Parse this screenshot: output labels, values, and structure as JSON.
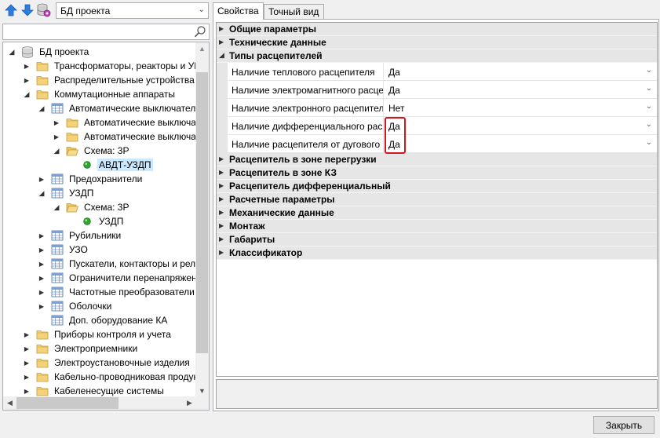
{
  "toolbar": {
    "up_icon": "arrow-up-icon",
    "down_icon": "arrow-down-icon",
    "db_icon": "database-settings-icon",
    "db_select_value": "БД проекта"
  },
  "search": {
    "value": "",
    "icon": "search-icon"
  },
  "tree": {
    "items": [
      {
        "label": "БД проекта",
        "icon": "database",
        "expander": "open",
        "depth": 0
      },
      {
        "label": "Трансформаторы, реакторы и УК",
        "icon": "folder",
        "expander": "closed",
        "depth": 1
      },
      {
        "label": "Распределительные устройства",
        "icon": "folder",
        "expander": "closed",
        "depth": 1
      },
      {
        "label": "Коммутационные аппараты",
        "icon": "folder",
        "expander": "open",
        "depth": 1
      },
      {
        "label": "Автоматические выключатели",
        "icon": "table",
        "expander": "open",
        "depth": 2
      },
      {
        "label": "Автоматические выключатели",
        "icon": "folder",
        "expander": "closed",
        "depth": 3
      },
      {
        "label": "Автоматические выключатели",
        "icon": "folder",
        "expander": "closed",
        "depth": 3
      },
      {
        "label": "Схема: 3P",
        "icon": "folder-open",
        "expander": "open",
        "depth": 3
      },
      {
        "label": "АВДТ-УЗДП",
        "icon": "green-dot",
        "expander": "none",
        "depth": 4,
        "selected": true
      },
      {
        "label": "Предохранители",
        "icon": "table",
        "expander": "closed",
        "depth": 2
      },
      {
        "label": "УЗДП",
        "icon": "table",
        "expander": "open",
        "depth": 2
      },
      {
        "label": "Схема: 3P",
        "icon": "folder-open",
        "expander": "open",
        "depth": 3
      },
      {
        "label": "УЗДП",
        "icon": "green-dot",
        "expander": "none",
        "depth": 4
      },
      {
        "label": "Рубильники",
        "icon": "table",
        "expander": "closed",
        "depth": 2
      },
      {
        "label": "УЗО",
        "icon": "table",
        "expander": "closed",
        "depth": 2
      },
      {
        "label": "Пускатели, контакторы и реле",
        "icon": "table",
        "expander": "closed",
        "depth": 2
      },
      {
        "label": "Ограничители перенапряжения",
        "icon": "table",
        "expander": "closed",
        "depth": 2
      },
      {
        "label": "Частотные преобразователи",
        "icon": "table",
        "expander": "closed",
        "depth": 2
      },
      {
        "label": "Оболочки",
        "icon": "table",
        "expander": "closed",
        "depth": 2
      },
      {
        "label": "Доп. оборудование КА",
        "icon": "table",
        "expander": "none",
        "depth": 2
      },
      {
        "label": "Приборы контроля и учета",
        "icon": "folder",
        "expander": "closed",
        "depth": 1
      },
      {
        "label": "Электроприемники",
        "icon": "folder",
        "expander": "closed",
        "depth": 1
      },
      {
        "label": "Электроустановочные изделия",
        "icon": "folder",
        "expander": "closed",
        "depth": 1
      },
      {
        "label": "Кабельно-проводниковая продукция",
        "icon": "folder",
        "expander": "closed",
        "depth": 1
      },
      {
        "label": "Кабеленесущие системы",
        "icon": "folder",
        "expander": "closed",
        "depth": 1
      }
    ]
  },
  "tabs": [
    {
      "label": "Свойства",
      "active": true
    },
    {
      "label": "Точный вид",
      "active": false
    }
  ],
  "grid": {
    "rows": [
      {
        "type": "category",
        "label": "Общие параметры",
        "expanded": false
      },
      {
        "type": "category",
        "label": "Технические данные",
        "expanded": false
      },
      {
        "type": "category",
        "label": "Типы расцепителей",
        "expanded": true
      },
      {
        "type": "property",
        "name": "Наличие теплового расцепителя",
        "value": "Да"
      },
      {
        "type": "property",
        "name": "Наличие электромагнитного расцепителя",
        "value": "Да"
      },
      {
        "type": "property",
        "name": "Наличие электронного расцепителя",
        "value": "Нет"
      },
      {
        "type": "property",
        "name": "Наличие дифференциального расцепителя",
        "value": "Да"
      },
      {
        "type": "property",
        "name": "Наличие расцепителя от дугового пробоя",
        "value": "Да"
      },
      {
        "type": "category",
        "label": "Расцепитель в зоне перегрузки",
        "expanded": false
      },
      {
        "type": "category",
        "label": "Расцепитель в зоне КЗ",
        "expanded": false
      },
      {
        "type": "category",
        "label": "Расцепитель дифференциальный",
        "expanded": false
      },
      {
        "type": "category",
        "label": "Расчетные параметры",
        "expanded": false
      },
      {
        "type": "category",
        "label": "Механические данные",
        "expanded": false
      },
      {
        "type": "category",
        "label": "Монтаж",
        "expanded": false
      },
      {
        "type": "category",
        "label": "Габариты",
        "expanded": false
      },
      {
        "type": "category",
        "label": "Классификатор",
        "expanded": false
      }
    ],
    "highlight_color": "#d0171b"
  },
  "footer": {
    "close_label": "Закрыть"
  }
}
